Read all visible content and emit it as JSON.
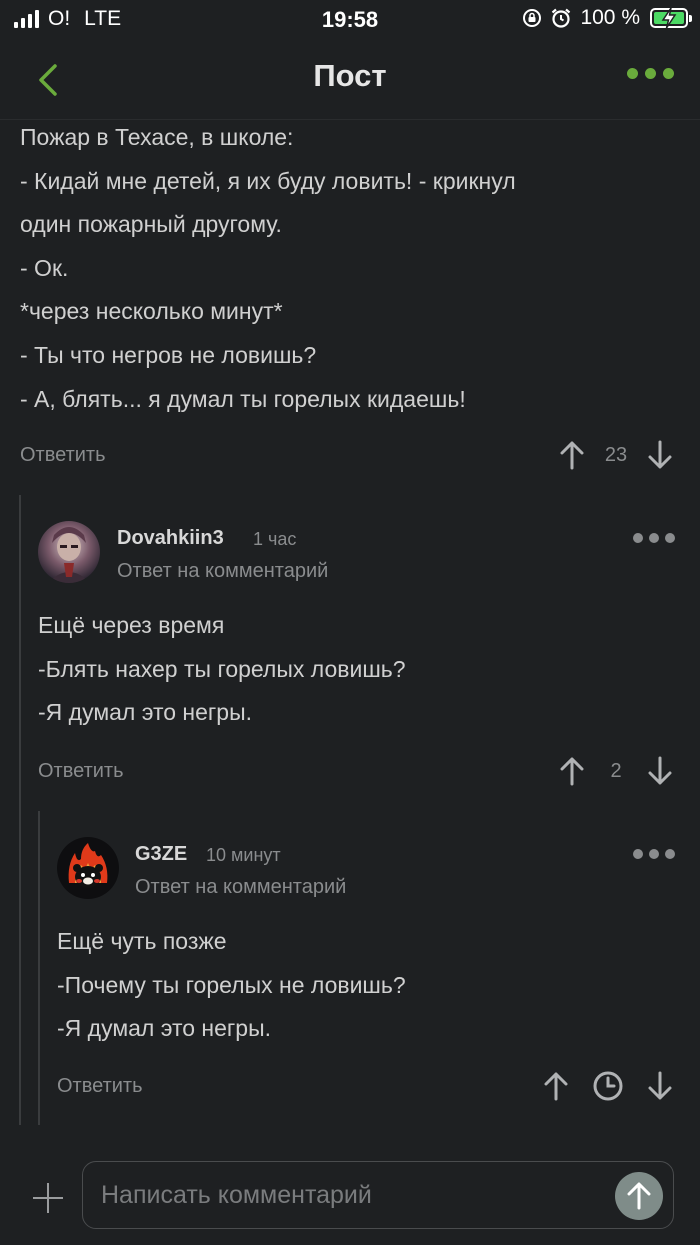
{
  "status_bar": {
    "carrier": "O!",
    "network": "LTE",
    "time": "19:58",
    "battery": "100 %",
    "battery_level": 1.0
  },
  "header": {
    "title": "Пост"
  },
  "comments": [
    {
      "lines": [
        "Пожар в Техасе, в школе:",
        "- Кидай мне детей, я их буду ловить! - крикнул",
        "один пожарный другому.",
        "- Ок.",
        "*через несколько минут*",
        "- Ты что негров не ловишь?",
        "- А, блять... я думал ты горелых кидаешь!"
      ],
      "reply_label": "Ответить",
      "rating": "23"
    },
    {
      "author": "Dovahkiin3",
      "time": "1 час",
      "reply_to": "Ответ на комментарий",
      "lines": [
        "Ещё через время",
        "-Блять нахер ты горелых ловишь?",
        "-Я думал это негры."
      ],
      "reply_label": "Ответить",
      "rating": "2"
    },
    {
      "author": "G3ZE",
      "time": "10 минут",
      "reply_to": "Ответ на комментарий",
      "lines": [
        "Ещё чуть позже",
        "-Почему ты горелых не ловишь?",
        "-Я думал это негры."
      ],
      "reply_label": "Ответить"
    }
  ],
  "compose": {
    "placeholder": "Написать комментарий"
  },
  "colors": {
    "accent": "#6aab3c",
    "background": "#1e2022",
    "battery": "#4cd964"
  }
}
